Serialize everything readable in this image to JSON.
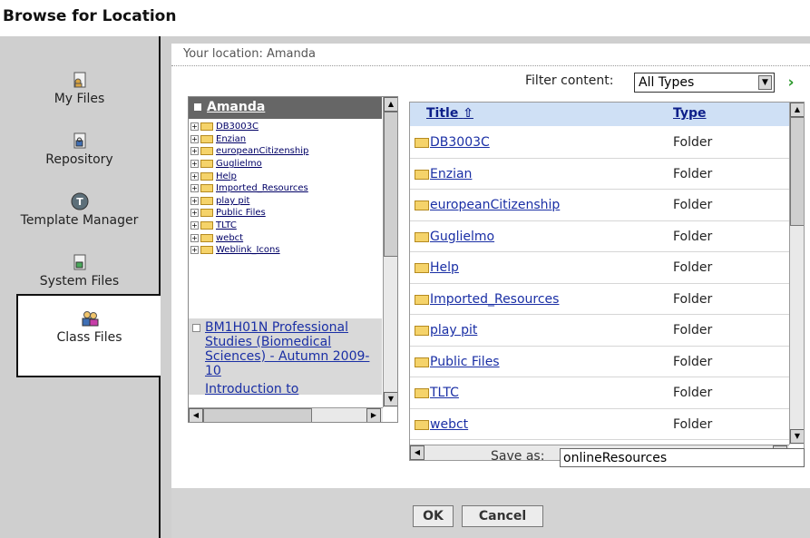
{
  "header": {
    "title": "Browse for Location"
  },
  "sidebar": {
    "items": [
      {
        "label": "My Files"
      },
      {
        "label": "Repository"
      },
      {
        "label": "Template Manager"
      },
      {
        "label": "System Files"
      },
      {
        "label": "Class Files"
      }
    ]
  },
  "location": "Your location: Amanda",
  "filter": {
    "label": "Filter content:",
    "value": "All Types"
  },
  "tree": {
    "root": "Amanda",
    "items": [
      "DB3003C",
      "Enzian",
      "europeanCitizenship",
      "Guglielmo",
      "Help",
      "Imported_Resources",
      "play pit",
      "Public Files",
      "TLTC",
      "webct",
      "Weblink_Icons"
    ],
    "class_item": "BM1H01N Professional Studies (Biomedical Sciences) - Autumn 2009-10",
    "class_item_partial": "Introduction to"
  },
  "files": {
    "col_title": "Title",
    "col_type": "Type",
    "rows": [
      {
        "name": "DB3003C",
        "type": "Folder"
      },
      {
        "name": "Enzian",
        "type": "Folder"
      },
      {
        "name": "europeanCitizenship",
        "type": "Folder"
      },
      {
        "name": "Guglielmo",
        "type": "Folder"
      },
      {
        "name": "Help",
        "type": "Folder"
      },
      {
        "name": "Imported_Resources",
        "type": "Folder"
      },
      {
        "name": "play pit",
        "type": "Folder"
      },
      {
        "name": "Public Files",
        "type": "Folder"
      },
      {
        "name": "TLTC",
        "type": "Folder"
      },
      {
        "name": "webct",
        "type": "Folder"
      }
    ]
  },
  "save_as": {
    "label": "Save as:",
    "value": "onlineResources"
  },
  "buttons": {
    "ok": "OK",
    "cancel": "Cancel"
  }
}
